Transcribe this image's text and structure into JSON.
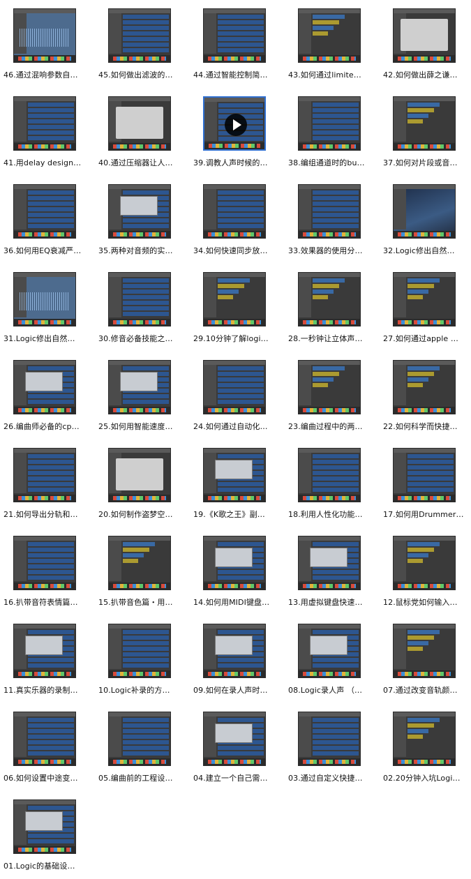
{
  "items": [
    {
      "label": "46.通过混响参数自…",
      "style": "wave"
    },
    {
      "label": "45.如何做出滤波的…",
      "style": "tracks"
    },
    {
      "label": "44.通过智能控制简…",
      "style": "tracks"
    },
    {
      "label": "43.如何通过limite…",
      "style": "mixer"
    },
    {
      "label": "42.如何做出薛之谦…",
      "style": "plugin"
    },
    {
      "label": "41.用delay design…",
      "style": "tracks"
    },
    {
      "label": "40.通过压缩器让人…",
      "style": "plugin"
    },
    {
      "label": "39.调教人声时候的…",
      "style": "tracks",
      "selected": true,
      "play": true
    },
    {
      "label": "38.编组通道时的bu…",
      "style": "tracks"
    },
    {
      "label": "37.如何对片段或音…",
      "style": "mixer"
    },
    {
      "label": "36.如何用EQ衰减严…",
      "style": "tracks"
    },
    {
      "label": "35.两种对音频的实…",
      "style": "dialog"
    },
    {
      "label": "34.如何快速同步放…",
      "style": "tracks"
    },
    {
      "label": "33.效果器的使用分…",
      "style": "tracks"
    },
    {
      "label": "32.Logic修出自然…",
      "style": "desktop"
    },
    {
      "label": "31.Logic修出自然…",
      "style": "wave"
    },
    {
      "label": "30.修音必备技能之…",
      "style": "tracks"
    },
    {
      "label": "29.10分钟了解logi…",
      "style": "mixer"
    },
    {
      "label": "28.一秒钟让立体声…",
      "style": "mixer"
    },
    {
      "label": "27.如何通过apple …",
      "style": "mixer"
    },
    {
      "label": "26.编曲师必备的cp…",
      "style": "dialog"
    },
    {
      "label": "25.如何用智能速度…",
      "style": "dialog"
    },
    {
      "label": "24.如何通过自动化…",
      "style": "tracks"
    },
    {
      "label": "23.编曲过程中的两…",
      "style": "mixer"
    },
    {
      "label": "22.如何科学而快捷…",
      "style": "mixer"
    },
    {
      "label": "21.如何导出分轨和…",
      "style": "tracks"
    },
    {
      "label": "20.如何制作盗梦空…",
      "style": "plugin"
    },
    {
      "label": "19.《K歌之王》副…",
      "style": "dialog"
    },
    {
      "label": "18.利用人性化功能…",
      "style": "tracks"
    },
    {
      "label": "17.如何用Drummer…",
      "style": "tracks"
    },
    {
      "label": "16.扒带音符表情篇…",
      "style": "tracks"
    },
    {
      "label": "15.扒带音色篇・用…",
      "style": "mixer"
    },
    {
      "label": "14.如何用MIDI键盘…",
      "style": "dialog"
    },
    {
      "label": "13.用虚拟键盘快速…",
      "style": "dialog"
    },
    {
      "label": "12.鼠标党如何输入…",
      "style": "mixer"
    },
    {
      "label": "11.真实乐器的录制…",
      "style": "dialog"
    },
    {
      "label": "10.Logic补录的方…",
      "style": "tracks"
    },
    {
      "label": "09.如何在录人声时…",
      "style": "dialog"
    },
    {
      "label": "08.Logic录人声 （…",
      "style": "dialog"
    },
    {
      "label": "07.通过改变音轨颜…",
      "style": "mixer"
    },
    {
      "label": "06.如何设置中途变…",
      "style": "tracks"
    },
    {
      "label": "05.编曲前的工程设…",
      "style": "tracks"
    },
    {
      "label": "04.建立一个自己需…",
      "style": "dialog"
    },
    {
      "label": "03.通过自定义快捷…",
      "style": "tracks"
    },
    {
      "label": "02.20分钟入坑Logi…",
      "style": "mixer"
    },
    {
      "label": "01.Logic的基础设…",
      "style": "dialog"
    }
  ]
}
